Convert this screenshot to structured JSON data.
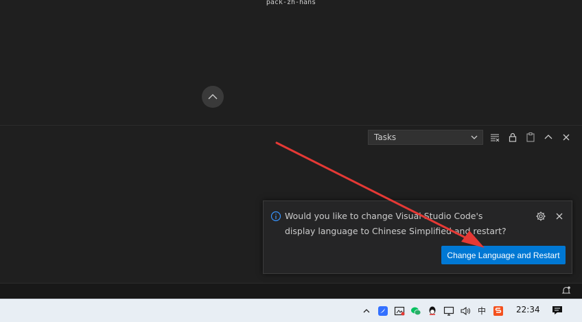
{
  "editor": {
    "top_label": "pack-zh-hans"
  },
  "panel": {
    "task_select": "Tasks"
  },
  "notification": {
    "message": "Would you like to change Visual Studio Code's display language to Chinese Simplified and restart?",
    "action_label": "Change Language and Restart",
    "accent": "#0078d4",
    "info_color": "#3794ff"
  },
  "taskbar": {
    "ime_label": "中",
    "clock": "22:34",
    "icons": [
      "chevron-up-icon",
      "feishu-icon",
      "screenshot-icon",
      "wechat-icon",
      "qq-icon",
      "network-icon",
      "volume-icon",
      "ime-icon",
      "sogou-icon",
      "notification-center-icon"
    ]
  },
  "annotation": {
    "arrow_color": "#e53935"
  }
}
